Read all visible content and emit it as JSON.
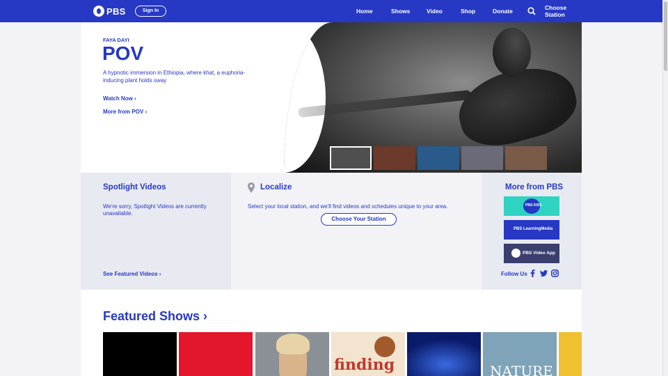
{
  "header": {
    "logo_text": "PBS",
    "sign_in": "Sign In",
    "nav": [
      {
        "id": "home",
        "label": "Home"
      },
      {
        "id": "shows",
        "label": "Shows"
      },
      {
        "id": "video",
        "label": "Video"
      },
      {
        "id": "shop",
        "label": "Shop"
      },
      {
        "id": "donate",
        "label": "Donate"
      }
    ],
    "choose_station_line1": "Choose",
    "choose_station_line2": "Station"
  },
  "hero": {
    "eyebrow": "FAYA DAYI",
    "title": "POV",
    "description": "A hypnotic immersion in Ethiopia, where khat, a euphoria-inducing plant holds sway",
    "watch_now": "Watch Now",
    "more_from": "More from POV",
    "thumbnails": [
      {
        "color": "#4f4f4f"
      },
      {
        "color": "#6b3a2b"
      },
      {
        "color": "#2a5a8a"
      },
      {
        "color": "#6a6a78"
      },
      {
        "color": "#7a5a48"
      }
    ]
  },
  "spotlight": {
    "title": "Spotlight Videos",
    "message": "We're sorry, Spotlight Videos are currently unavailable.",
    "link": "See Featured Videos"
  },
  "localize": {
    "title": "Localize",
    "text": "Select your local station, and we'll find videos and schedules unique to your area.",
    "button": "Choose Your Station"
  },
  "more_pbs": {
    "title": "More from PBS",
    "promos": [
      {
        "id": "pbs-kids",
        "label": "PBS KIDS",
        "color": "#2fd3c2"
      },
      {
        "id": "learning-media",
        "label": "PBS LearningMedia",
        "color": "#2638c4"
      },
      {
        "id": "video-app",
        "label": "PBS Video App",
        "color": "#3a3f6e"
      }
    ],
    "follow_us": "Follow Us"
  },
  "featured": {
    "title": "Featured Shows",
    "shows": [
      {
        "id": "show-1",
        "color": "#000000"
      },
      {
        "id": "show-2",
        "color": "#e3162b"
      },
      {
        "id": "show-3",
        "color": "#8b8f96"
      },
      {
        "id": "show-4",
        "label": "finding",
        "color": "#f2e4cf"
      },
      {
        "id": "show-5",
        "color": "#0a1a6a"
      },
      {
        "id": "show-6",
        "label": "NATURE",
        "color": "#7fa3b8"
      },
      {
        "id": "show-7",
        "color": "#f0c030"
      }
    ]
  },
  "colors": {
    "brand": "#2638c4",
    "panel": "#e8eaf2"
  }
}
